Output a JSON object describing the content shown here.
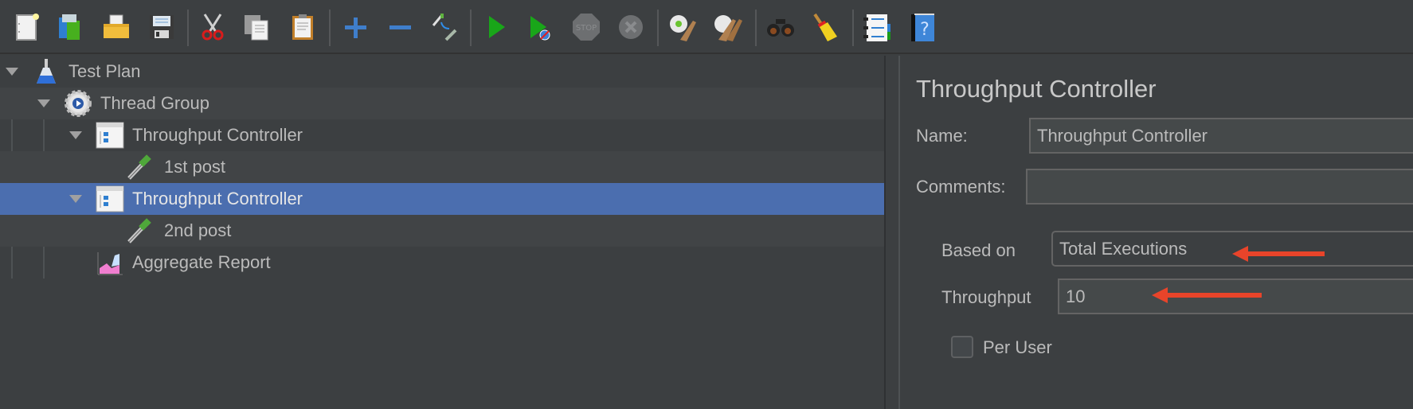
{
  "toolbar": {
    "buttons": [
      {
        "id": "new",
        "icon": "new-document-icon"
      },
      {
        "id": "templates",
        "icon": "templates-icon"
      },
      {
        "id": "open",
        "icon": "open-folder-icon"
      },
      {
        "id": "save",
        "icon": "save-floppy-icon"
      },
      {
        "id": "cut",
        "icon": "scissors-icon"
      },
      {
        "id": "copy",
        "icon": "copy-icon"
      },
      {
        "id": "paste",
        "icon": "clipboard-paste-icon"
      },
      {
        "id": "expand",
        "icon": "plus-icon"
      },
      {
        "id": "collapse",
        "icon": "minus-icon"
      },
      {
        "id": "toggle",
        "icon": "toggle-enable-icon"
      },
      {
        "id": "start",
        "icon": "play-icon"
      },
      {
        "id": "start-no-pauses",
        "icon": "play-no-timers-icon"
      },
      {
        "id": "stop",
        "icon": "stop-sign-icon"
      },
      {
        "id": "shutdown",
        "icon": "shutdown-x-icon"
      },
      {
        "id": "clear",
        "icon": "clear-gear-broom-icon"
      },
      {
        "id": "clear-all",
        "icon": "clear-all-icon"
      },
      {
        "id": "search",
        "icon": "binoculars-icon"
      },
      {
        "id": "reset-search",
        "icon": "broom-icon"
      },
      {
        "id": "function-helper",
        "icon": "function-list-icon"
      },
      {
        "id": "help",
        "icon": "help-book-icon"
      }
    ]
  },
  "tree": {
    "nodes": [
      {
        "label": "Test Plan",
        "icon": "flask-icon",
        "level": 0,
        "expanded": true
      },
      {
        "label": "Thread Group",
        "icon": "gear-icon",
        "level": 1,
        "expanded": true
      },
      {
        "label": "Throughput Controller",
        "icon": "controller-icon",
        "level": 2,
        "expanded": true
      },
      {
        "label": "1st post",
        "icon": "sampler-pipette-icon",
        "level": 3
      },
      {
        "label": "Throughput Controller",
        "icon": "controller-icon",
        "level": 2,
        "expanded": true,
        "selected": true
      },
      {
        "label": "2nd post",
        "icon": "sampler-pipette-icon",
        "level": 3
      },
      {
        "label": "Aggregate Report",
        "icon": "aggregate-chart-icon",
        "level": 2
      }
    ]
  },
  "panel": {
    "title": "Throughput Controller",
    "name_label": "Name:",
    "name_value": "Throughput Controller",
    "comments_label": "Comments:",
    "comments_value": "",
    "based_on_label": "Based on",
    "based_on_value": "Total Executions",
    "throughput_label": "Throughput",
    "throughput_value": "10",
    "per_user_label": "Per User",
    "per_user_checked": false
  },
  "colors": {
    "background": "#3c3f41",
    "selection": "#4b6eaf",
    "annotation_arrow": "#e8442a"
  }
}
